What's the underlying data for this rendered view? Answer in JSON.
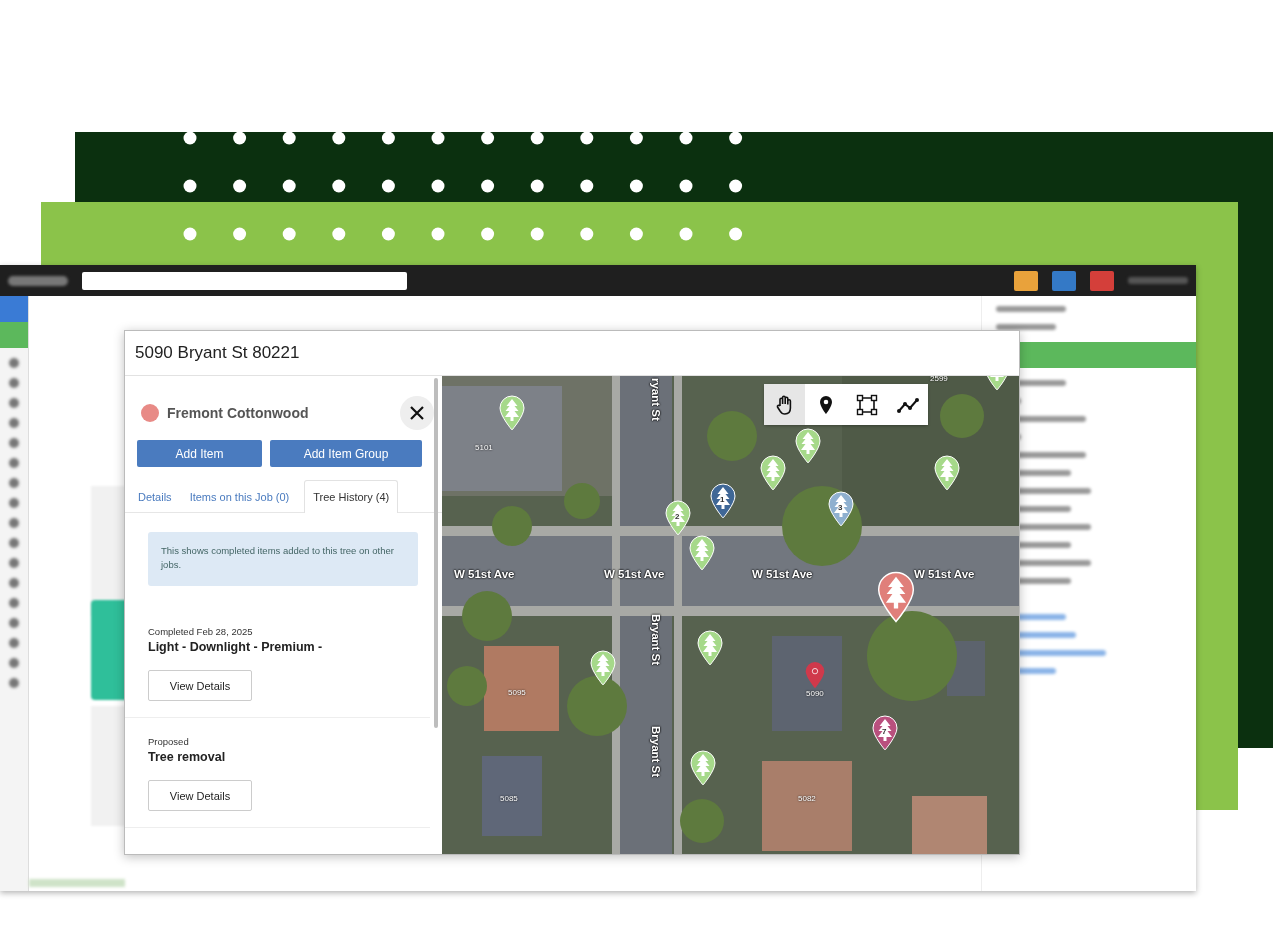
{
  "dialog": {
    "title": "5090 Bryant St 80221",
    "tree": {
      "name": "Fremont Cottonwood",
      "color": "#e88a86"
    },
    "actions": [
      "Add Item",
      "Add Item Group"
    ],
    "tabs": [
      {
        "label": "Details",
        "selected": false
      },
      {
        "label": "Items on this Job (0)",
        "selected": false
      },
      {
        "label": "Tree History (4)",
        "selected": true
      }
    ],
    "notice": "This shows completed items added to this tree on other jobs.",
    "history": [
      {
        "status": "Completed Feb 28, 2025",
        "title": "Light - Downlight - Premium -",
        "button": "View Details"
      },
      {
        "status": "Proposed",
        "title": "Tree removal",
        "button": "View Details"
      }
    ]
  },
  "map": {
    "tools": [
      {
        "kind": "pan",
        "selected": true
      },
      {
        "kind": "pin",
        "selected": false
      },
      {
        "kind": "area",
        "selected": false
      },
      {
        "kind": "line",
        "selected": false
      }
    ],
    "street_labels": [
      {
        "text": "W 51st Ave",
        "vertical": false
      },
      {
        "text": "W 51st Ave",
        "vertical": false
      },
      {
        "text": "W 51st Ave",
        "vertical": false
      },
      {
        "text": "W 51st Ave",
        "vertical": false
      },
      {
        "text": "ryant St",
        "vertical": true
      },
      {
        "text": "Bryant St",
        "vertical": true
      },
      {
        "text": "Bryant St",
        "vertical": true
      }
    ],
    "house_numbers": [
      "5101",
      "2599",
      "5095",
      "5090",
      "5085",
      "5082"
    ],
    "pins": [
      {
        "kind": "tree",
        "color": "#a6d98a"
      },
      {
        "kind": "tree",
        "color": "#a6d98a"
      },
      {
        "kind": "tree",
        "color": "#a6d98a"
      },
      {
        "kind": "tree",
        "color": "#a6d98a"
      },
      {
        "kind": "tree",
        "color": "#a6d98a",
        "number": "2"
      },
      {
        "kind": "tree",
        "color": "#3f6796",
        "number": "1"
      },
      {
        "kind": "tree",
        "color": "#8fb0cf",
        "number": "3"
      },
      {
        "kind": "tree",
        "color": "#a6d98a"
      },
      {
        "kind": "tree-large",
        "color": "#e07f7a"
      },
      {
        "kind": "tree",
        "color": "#a6d98a"
      },
      {
        "kind": "tree",
        "color": "#a6d98a"
      },
      {
        "kind": "location",
        "color": "#d0394b"
      },
      {
        "kind": "tree",
        "color": "#b9507e",
        "number": "7"
      },
      {
        "kind": "tree",
        "color": "#a6d98a"
      },
      {
        "kind": "tree",
        "color": "#a6d98a"
      }
    ]
  }
}
